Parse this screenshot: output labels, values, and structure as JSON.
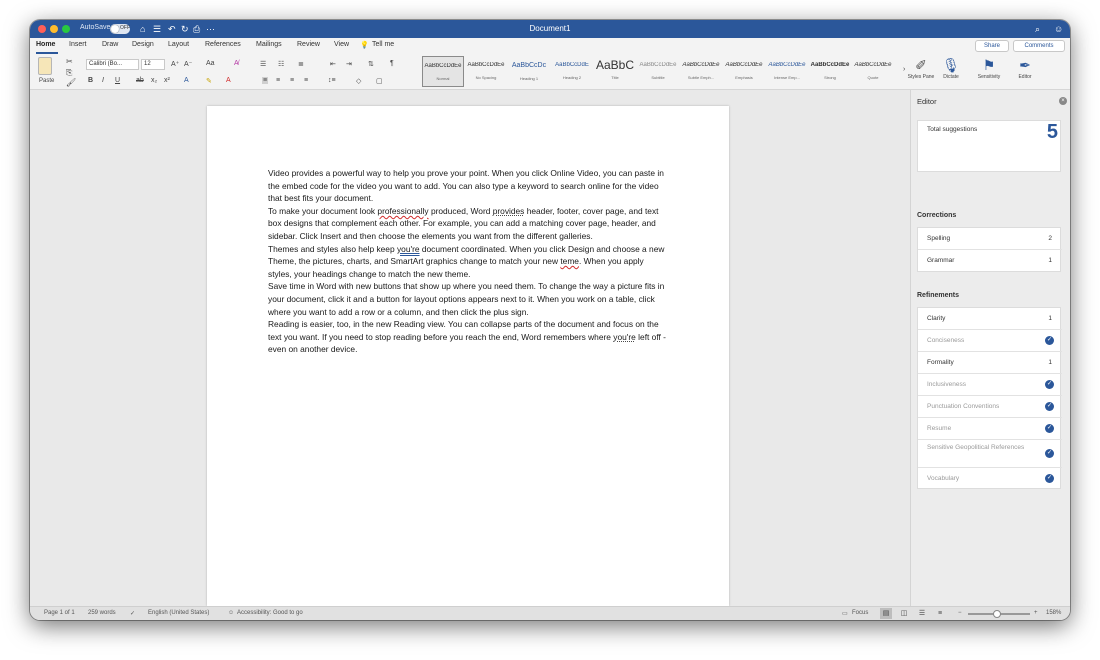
{
  "titlebar": {
    "autosave_label": "AutoSave",
    "autosave_state": "OFF",
    "doc_title": "Document1"
  },
  "tabs": [
    "Home",
    "Insert",
    "Draw",
    "Design",
    "Layout",
    "References",
    "Mailings",
    "Review",
    "View"
  ],
  "tell_me": "Tell me",
  "share_label": "Share",
  "comments_label": "Comments",
  "ribbon": {
    "paste_label": "Paste",
    "font_name": "Calibri (Bo...",
    "font_size": "12",
    "styles": [
      {
        "sample": "AaBbCcDdEe",
        "name": "Normal"
      },
      {
        "sample": "AaBbCcDdEe",
        "name": "No Spacing"
      },
      {
        "sample": "AaBbCcDc",
        "name": "Heading 1"
      },
      {
        "sample": "AaBbCcDdE",
        "name": "Heading 2"
      },
      {
        "sample": "AaBbC",
        "name": "Title"
      },
      {
        "sample": "AaBbCcDdEe",
        "name": "Subtitle"
      },
      {
        "sample": "AaBbCcDdEe",
        "name": "Subtle Emph..."
      },
      {
        "sample": "AaBbCcDdEe",
        "name": "Emphasis"
      },
      {
        "sample": "AaBbCcDdEe",
        "name": "Intense Emp..."
      },
      {
        "sample": "AaBbCcDdEe",
        "name": "Strong"
      },
      {
        "sample": "AaBbCcDdEe",
        "name": "Quote"
      }
    ],
    "styles_pane_label": "Styles Pane",
    "dictate_label": "Dictate",
    "sensitivity_label": "Sensitivity",
    "editor_label": "Editor"
  },
  "document": {
    "p1": "Video provides a powerful way to help you prove your point. When you click Online Video, you can paste in the embed code for the video you want to add. You can also type a keyword to search online for the video that best fits your document.",
    "p2a": "To make your document look ",
    "p2_err1": "professionally",
    "p2b": " produced, Word ",
    "p2_err2": "provides",
    "p2c": " header, footer, cover page, and text box designs that complement each other. For example, you can add a matching cover page, header, and sidebar. Click Insert and then choose the elements you want from the different galleries.",
    "p3a": "Themes and styles also help keep ",
    "p3_err1": "you're",
    "p3b": " document coordinated. When you click Design and choose a new Theme, the pictures, charts, and SmartArt graphics change to match your new ",
    "p3_err2": "teme",
    "p3c": ". When you apply styles, your headings change to match the new theme.",
    "p4": "Save time in Word with new buttons that show up where you need them. To change the way a picture fits in your document, click it and a button for layout options appears next to it. When you work on a table, click where you want to add a row or a column, and then click the plus sign.",
    "p5a": "Reading is easier, too, in the new Reading view. You can collapse parts of the document and focus on the text you want. If you need to stop reading before you reach the end, Word remembers where ",
    "p5_err1": "you're",
    "p5b": " left off - even on another device."
  },
  "editor": {
    "title": "Editor",
    "total_label": "Total suggestions",
    "total_count": "5",
    "corrections_label": "Corrections",
    "corrections": [
      {
        "label": "Spelling",
        "count": "2"
      },
      {
        "label": "Grammar",
        "count": "1"
      }
    ],
    "refinements_label": "Refinements",
    "refinements": [
      {
        "label": "Clarity",
        "count": "1",
        "done": false
      },
      {
        "label": "Conciseness",
        "done": true
      },
      {
        "label": "Formality",
        "count": "1",
        "done": false
      },
      {
        "label": "Inclusiveness",
        "done": true
      },
      {
        "label": "Punctuation Conventions",
        "done": true
      },
      {
        "label": "Resume",
        "done": true
      },
      {
        "label": "Sensitive Geopolitical References",
        "done": true
      },
      {
        "label": "Vocabulary",
        "done": true
      }
    ]
  },
  "status": {
    "page": "Page 1 of 1",
    "words": "259 words",
    "language": "English (United States)",
    "accessibility": "Accessibility: Good to go",
    "focus": "Focus",
    "zoom": "158%"
  },
  "colors": {
    "accent": "#2b579a",
    "spelling_squiggle": "#d12b2b"
  }
}
